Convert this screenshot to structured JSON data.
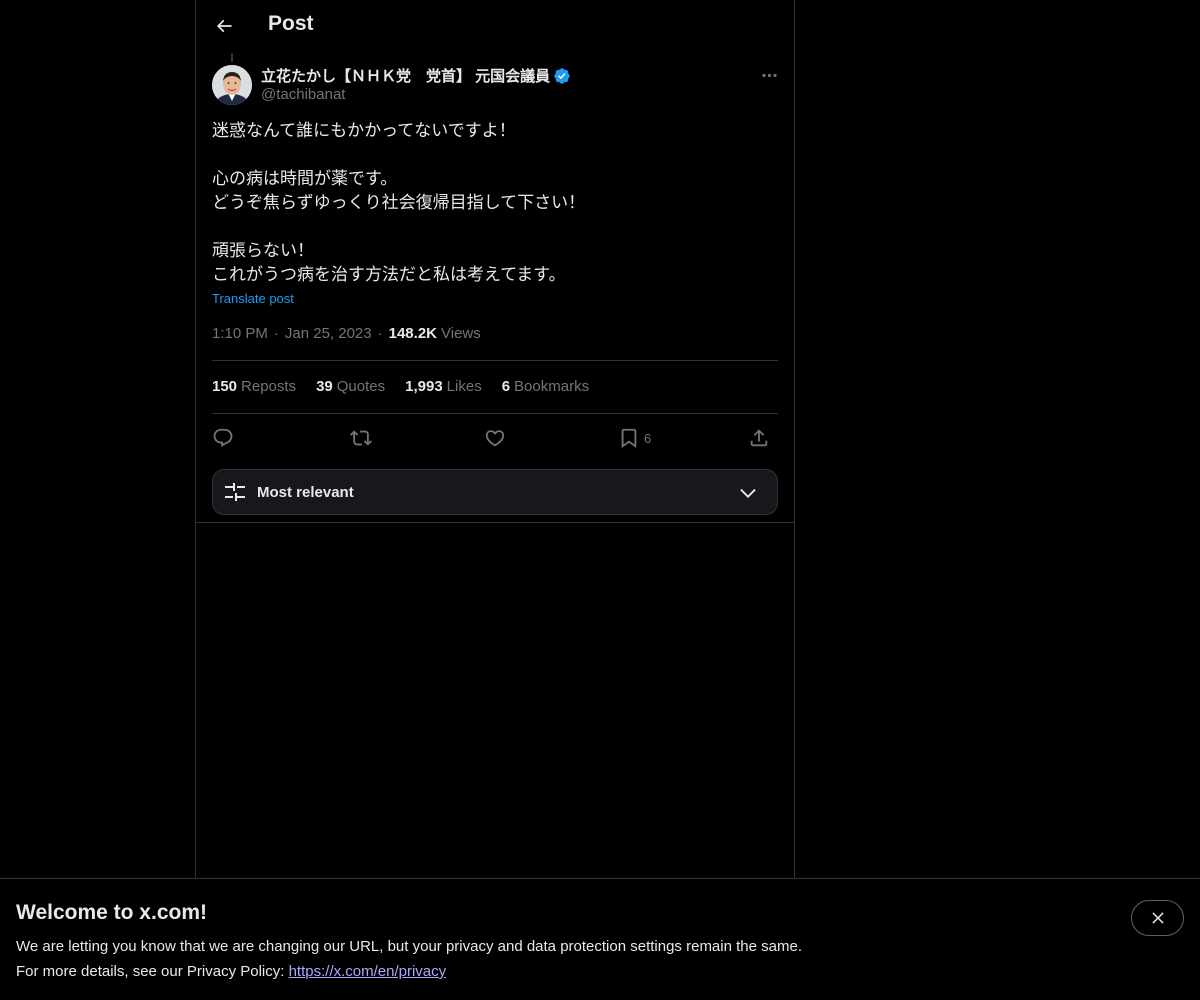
{
  "header": {
    "title": "Post"
  },
  "author": {
    "display_name": "立花たかし【ＮＨＫ党　党首】 元国会議員",
    "handle": "@tachibanat",
    "verified": true
  },
  "post": {
    "text": "迷惑なんて誰にもかかってないですよ！\n\n心の病は時間が薬です。\nどうぞ焦らずゆっくり社会復帰目指して下さい！\n\n頑張らない！\nこれがうつ病を治す方法だと私は考えてます。",
    "translate_label": "Translate post",
    "time": "1:10 PM",
    "date": "Jan 25, 2023",
    "separator": "·",
    "views_count": "148.2K",
    "views_label": "Views"
  },
  "stats": {
    "reposts_count": "150",
    "reposts_label": "Reposts",
    "quotes_count": "39",
    "quotes_label": "Quotes",
    "likes_count": "1,993",
    "likes_label": "Likes",
    "bookmarks_count": "6",
    "bookmarks_label": "Bookmarks"
  },
  "actions": {
    "bookmark_count": "6"
  },
  "sort": {
    "label": "Most relevant"
  },
  "banner": {
    "title": "Welcome to x.com!",
    "line1": "We are letting you know that we are changing our URL, but your privacy and data protection settings remain the same.",
    "line2_prefix": "For more details, see our Privacy Policy: ",
    "link": "https://x.com/en/privacy"
  },
  "colors": {
    "background": "#000000",
    "text": "#e7e9ea",
    "secondary": "#71767b",
    "accent": "#1d9bf0",
    "border": "#2f3336"
  },
  "icons": [
    "back-arrow-icon",
    "verified-badge-icon",
    "more-options-icon",
    "reply-icon",
    "repost-icon",
    "like-icon",
    "bookmark-icon",
    "share-icon",
    "sort-filter-icon",
    "chevron-down-icon",
    "close-icon"
  ]
}
